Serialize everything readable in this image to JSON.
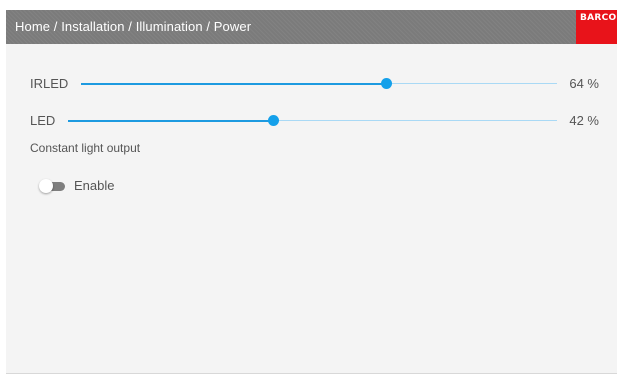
{
  "header": {
    "breadcrumb": "Home / Installation / Illumination / Power",
    "logo_text": "BARCO"
  },
  "sliders": [
    {
      "label": "IRLED",
      "value_text": "64 %",
      "value": 64
    },
    {
      "label": "LED",
      "value_text": "42 %",
      "value": 42
    }
  ],
  "constant_light": {
    "title": "Constant light output",
    "toggle_label": "Enable",
    "enabled": false
  },
  "colors": {
    "accent": "#14a0ea",
    "track": "#a9d9f5",
    "header_bg": "#7b7b7b",
    "brand": "#e8131a",
    "panel_bg": "#f4f4f4"
  }
}
